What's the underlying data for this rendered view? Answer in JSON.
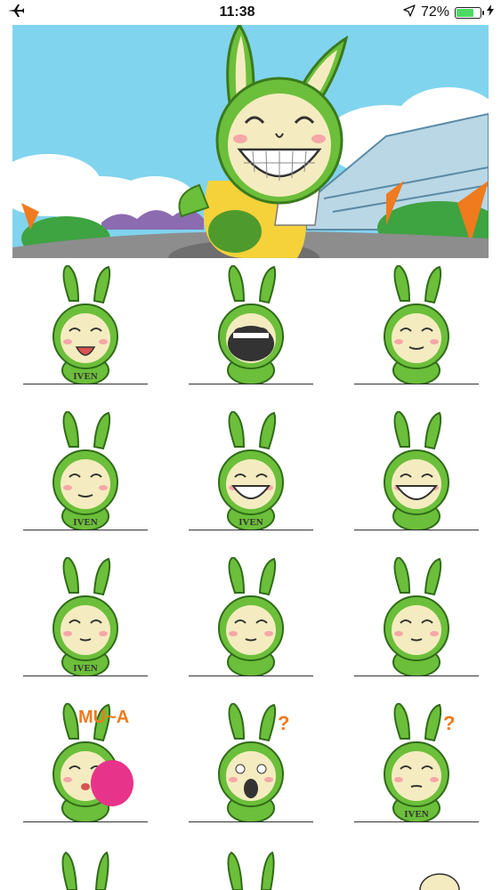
{
  "status_bar": {
    "mode_icon": "airplane-icon",
    "time": "11:38",
    "location_icon": "location-arrow-icon",
    "battery_percent_text": "72%",
    "battery_level": 0.72,
    "charging_icon": "bolt-icon"
  },
  "banner": {
    "description_icon": "grinning-green-bunny-banner"
  },
  "stickers": [
    {
      "name": "laughing-bunny",
      "label": "IVEN"
    },
    {
      "name": "yawning-bunny",
      "label": ""
    },
    {
      "name": "sleeping-bunny",
      "label": ""
    },
    {
      "name": "fan-bunny",
      "label": "IVEN"
    },
    {
      "name": "grinning-bunny-with-paper",
      "label": "IVEN"
    },
    {
      "name": "big-smile-bunny",
      "label": ""
    },
    {
      "name": "calm-bunny",
      "label": "IVEN"
    },
    {
      "name": "lying-bunny",
      "label": ""
    },
    {
      "name": "tea-bunny",
      "label": ""
    },
    {
      "name": "kiss-bunny",
      "label": "MU~A"
    },
    {
      "name": "shocked-bunny",
      "label": ""
    },
    {
      "name": "question-bunny",
      "label": "IVEN"
    }
  ],
  "colors": {
    "bunny_green": "#6cbf3a",
    "bunny_face": "#f4ecc0",
    "sky": "#7ad3ef",
    "accent_orange": "#f07a1e",
    "accent_pink": "#e8338a"
  }
}
